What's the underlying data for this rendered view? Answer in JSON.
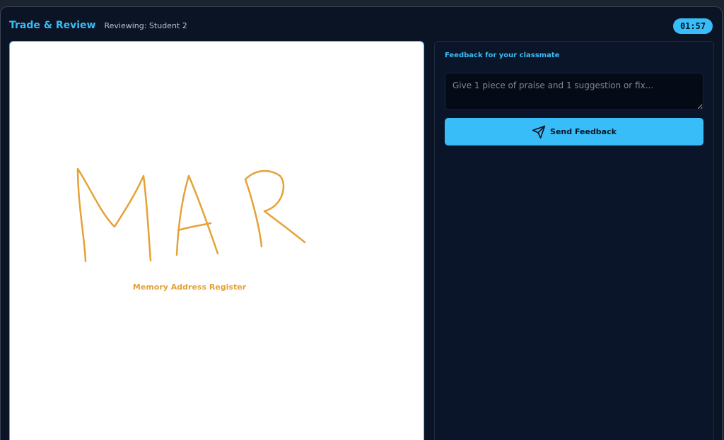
{
  "header": {
    "title": "Trade & Review",
    "subtitle": "Reviewing: Student 2",
    "timer": "01:57"
  },
  "drawing": {
    "handwritten_text": "MAR",
    "caption": "Memory Address Register",
    "ink_color": "#e5a237"
  },
  "feedback": {
    "heading": "Feedback for your classmate",
    "placeholder": "Give 1 piece of praise and 1 suggestion or fix...",
    "value": "",
    "send_label": "Send Feedback",
    "send_icon": "send-icon"
  },
  "colors": {
    "accent": "#38bdf8",
    "background": "#0b1424",
    "panel": "#0a1529",
    "ink": "#e5a237"
  }
}
